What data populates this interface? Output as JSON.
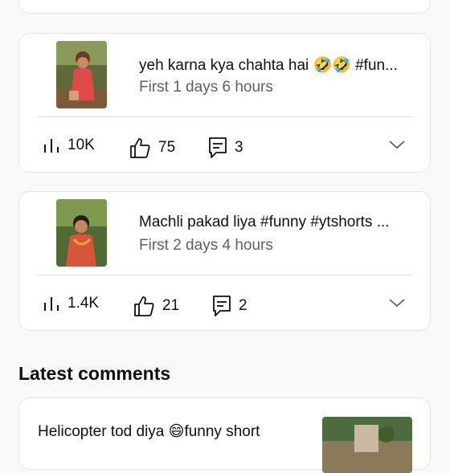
{
  "videos": [
    {
      "title": "yeh karna kya chahta hai 🤣🤣 #fun...",
      "age": "First 1 days 6 hours",
      "views": "10K",
      "likes": "75",
      "comments": "3"
    },
    {
      "title": "Machli pakad liya #funny #ytshorts ...",
      "age": "First 2 days 4 hours",
      "views": "1.4K",
      "likes": "21",
      "comments": "2"
    }
  ],
  "latest_comments": {
    "heading": "Latest comments",
    "items": [
      {
        "text": "Helicopter tod diya 😄funny short"
      }
    ]
  },
  "icons": {
    "views": "bar-chart-icon",
    "likes": "thumbs-up-icon",
    "comments": "comment-icon",
    "expand": "chevron-down-icon"
  },
  "colors": {
    "background": "#f9f9f9",
    "card": "#ffffff",
    "secondary_text": "#606060"
  }
}
